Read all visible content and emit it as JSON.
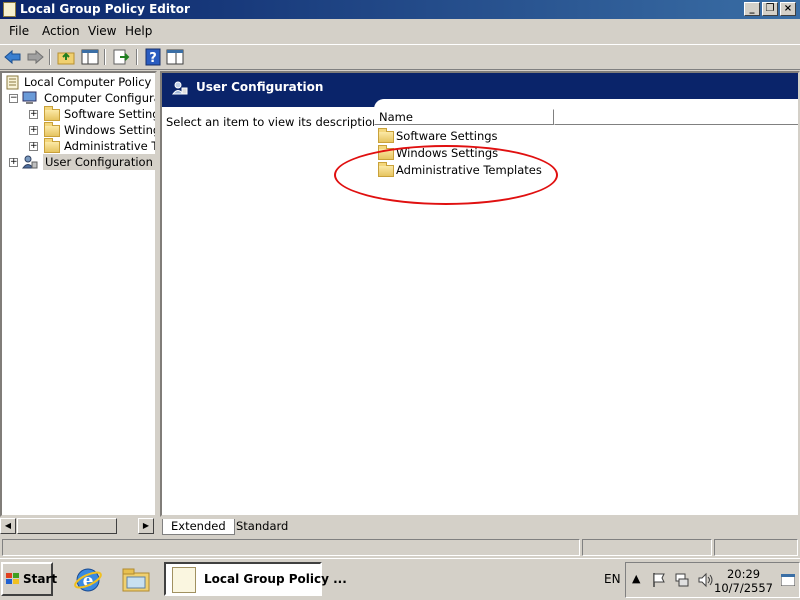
{
  "window": {
    "title": "Local Group Policy Editor"
  },
  "menu": {
    "items": [
      "File",
      "Action",
      "View",
      "Help"
    ]
  },
  "tree": {
    "root": "Local Computer Policy",
    "computer_config": "Computer Configuratio",
    "software_settings": "Software Settings",
    "windows_settings": "Windows Settings",
    "admin_templates": "Administrative Tem",
    "user_config": "User Configuration"
  },
  "details": {
    "header_title": "User Configuration",
    "description": "Select an item to view its description.",
    "column_name": "Name",
    "items": [
      "Software Settings",
      "Windows Settings",
      "Administrative Templates"
    ]
  },
  "tabs": {
    "extended": "Extended",
    "standard": "Standard"
  },
  "taskbar": {
    "start_label": "Start",
    "task_label": "Local Group Policy ...",
    "language": "EN",
    "time": "20:29",
    "date": "10/7/2557"
  },
  "colors": {
    "header_band": "#0a246a",
    "annotation": "#e01010",
    "titlebar": "#0a246a"
  }
}
